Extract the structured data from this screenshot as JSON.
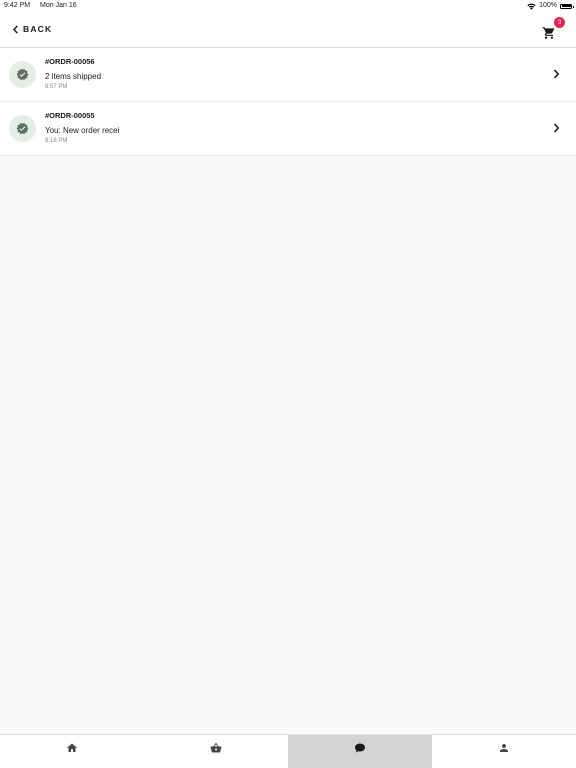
{
  "status_bar": {
    "time": "9:42 PM",
    "date": "Mon Jan 16",
    "battery": "100%"
  },
  "header": {
    "back_label": "BACK",
    "cart_count": "3"
  },
  "orders": [
    {
      "title": "#ORDR-00056",
      "message": "2 items shipped",
      "time": "8:57 PM"
    },
    {
      "title": "#ORDR-00055",
      "message": "You: New order recei",
      "time": "8:18 PM"
    }
  ],
  "bottom_nav": {
    "tabs": [
      {
        "icon": "home-icon",
        "active": false
      },
      {
        "icon": "basket-icon",
        "active": false
      },
      {
        "icon": "chat-icon",
        "active": true
      },
      {
        "icon": "person-icon",
        "active": false
      }
    ]
  },
  "colors": {
    "accent_badge": "#e8224b",
    "avatar_bg": "#e3efe3",
    "active_tab": "#d4d4d4"
  }
}
